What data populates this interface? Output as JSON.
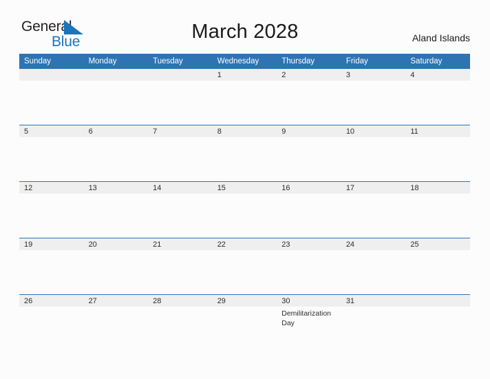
{
  "brand": {
    "name_part1": "General",
    "name_part2": "Blue",
    "flag_icon": "blue-triangle-flag-icon",
    "accent_color": "#1b75bb"
  },
  "header": {
    "title": "March 2028",
    "region": "Aland Islands"
  },
  "theme": {
    "header_blue": "#2e73b2",
    "date_band": "#efefef",
    "page_background": "#fcfcfd",
    "text": "#2b2b2b"
  },
  "calendar": {
    "weekday_headers": [
      "Sunday",
      "Monday",
      "Tuesday",
      "Wednesday",
      "Thursday",
      "Friday",
      "Saturday"
    ],
    "weeks": [
      [
        {
          "day": "",
          "event": ""
        },
        {
          "day": "",
          "event": ""
        },
        {
          "day": "",
          "event": ""
        },
        {
          "day": "1",
          "event": ""
        },
        {
          "day": "2",
          "event": ""
        },
        {
          "day": "3",
          "event": ""
        },
        {
          "day": "4",
          "event": ""
        }
      ],
      [
        {
          "day": "5",
          "event": ""
        },
        {
          "day": "6",
          "event": ""
        },
        {
          "day": "7",
          "event": ""
        },
        {
          "day": "8",
          "event": ""
        },
        {
          "day": "9",
          "event": ""
        },
        {
          "day": "10",
          "event": ""
        },
        {
          "day": "11",
          "event": ""
        }
      ],
      [
        {
          "day": "12",
          "event": ""
        },
        {
          "day": "13",
          "event": ""
        },
        {
          "day": "14",
          "event": ""
        },
        {
          "day": "15",
          "event": ""
        },
        {
          "day": "16",
          "event": ""
        },
        {
          "day": "17",
          "event": ""
        },
        {
          "day": "18",
          "event": ""
        }
      ],
      [
        {
          "day": "19",
          "event": ""
        },
        {
          "day": "20",
          "event": ""
        },
        {
          "day": "21",
          "event": ""
        },
        {
          "day": "22",
          "event": ""
        },
        {
          "day": "23",
          "event": ""
        },
        {
          "day": "24",
          "event": ""
        },
        {
          "day": "25",
          "event": ""
        }
      ],
      [
        {
          "day": "26",
          "event": ""
        },
        {
          "day": "27",
          "event": ""
        },
        {
          "day": "28",
          "event": ""
        },
        {
          "day": "29",
          "event": ""
        },
        {
          "day": "30",
          "event": "Demilitarization Day"
        },
        {
          "day": "31",
          "event": ""
        },
        {
          "day": "",
          "event": ""
        }
      ]
    ]
  }
}
